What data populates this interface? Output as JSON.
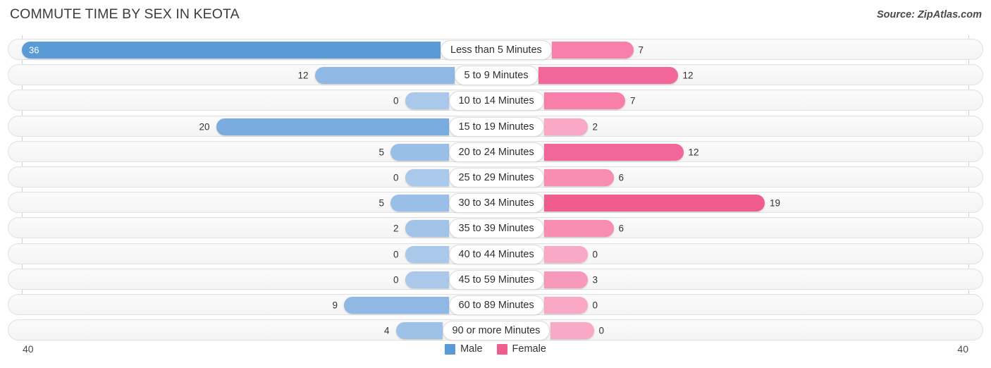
{
  "header": {
    "title": "COMMUTE TIME BY SEX IN KEOTA",
    "source": "Source: ZipAtlas.com"
  },
  "axis": {
    "left_tick": "40",
    "right_tick": "40"
  },
  "legend": {
    "items": [
      {
        "label": "Male",
        "color": "#5b9bd5"
      },
      {
        "label": "Female",
        "color": "#ef5d90"
      }
    ]
  },
  "chart_data": {
    "type": "bar",
    "title": "COMMUTE TIME BY SEX IN KEOTA",
    "subtitle": "Source: ZipAtlas.com",
    "orientation": "horizontal-diverging",
    "xlabel": "",
    "ylabel": "",
    "xlim": [
      40,
      40
    ],
    "axis_left_max": 40,
    "axis_right_max": 40,
    "grid": false,
    "legend_position": "bottom-center",
    "categories": [
      "Less than 5 Minutes",
      "5 to 9 Minutes",
      "10 to 14 Minutes",
      "15 to 19 Minutes",
      "20 to 24 Minutes",
      "25 to 29 Minutes",
      "30 to 34 Minutes",
      "35 to 39 Minutes",
      "40 to 44 Minutes",
      "45 to 59 Minutes",
      "60 to 89 Minutes",
      "90 or more Minutes"
    ],
    "series": [
      {
        "name": "Male",
        "color": "#5b9bd5",
        "values": [
          36,
          12,
          0,
          20,
          5,
          0,
          5,
          2,
          0,
          0,
          9,
          4
        ],
        "labels": [
          "36",
          "12",
          "0",
          "20",
          "5",
          "0",
          "5",
          "2",
          "0",
          "0",
          "9",
          "4"
        ]
      },
      {
        "name": "Female",
        "color": "#ef5d90",
        "values": [
          7,
          12,
          7,
          2,
          12,
          6,
          19,
          6,
          0,
          3,
          0,
          0
        ],
        "labels": [
          "7",
          "12",
          "7",
          "2",
          "12",
          "6",
          "19",
          "6",
          "0",
          "3",
          "0",
          "0"
        ]
      }
    ],
    "rows": [
      {
        "label": "Less than 5 Minutes",
        "male": 36,
        "female": 7,
        "male_label": "36",
        "female_label": "7",
        "male_color": "#5b9bd5",
        "female_color": "#f87fa9"
      },
      {
        "label": "5 to 9 Minutes",
        "male": 12,
        "female": 12,
        "male_label": "12",
        "female_label": "12",
        "male_color": "#8fb8e4",
        "female_color": "#f2679a"
      },
      {
        "label": "10 to 14 Minutes",
        "male": 0,
        "female": 7,
        "male_label": "0",
        "female_label": "7",
        "male_color": "#a9c8ea",
        "female_color": "#f87fa9"
      },
      {
        "label": "15 to 19 Minutes",
        "male": 20,
        "female": 2,
        "male_label": "20",
        "female_label": "2",
        "male_color": "#7aace0",
        "female_color": "#f9a8c5"
      },
      {
        "label": "20 to 24 Minutes",
        "male": 5,
        "female": 12,
        "male_label": "5",
        "female_label": "12",
        "male_color": "#99bfe7",
        "female_color": "#f2679a"
      },
      {
        "label": "25 to 29 Minutes",
        "male": 0,
        "female": 6,
        "male_label": "0",
        "female_label": "6",
        "male_color": "#a9c8ea",
        "female_color": "#f88cb1"
      },
      {
        "label": "30 to 34 Minutes",
        "male": 5,
        "female": 19,
        "male_label": "5",
        "female_label": "19",
        "male_color": "#99bfe7",
        "female_color": "#ef5d90"
      },
      {
        "label": "35 to 39 Minutes",
        "male": 2,
        "female": 6,
        "male_label": "2",
        "female_label": "6",
        "male_color": "#a2c3e8",
        "female_color": "#f88cb1"
      },
      {
        "label": "40 to 44 Minutes",
        "male": 0,
        "female": 0,
        "male_label": "0",
        "female_label": "0",
        "male_color": "#a9c8ea",
        "female_color": "#f9a8c5"
      },
      {
        "label": "45 to 59 Minutes",
        "male": 0,
        "female": 3,
        "male_label": "0",
        "female_label": "3",
        "male_color": "#a9c8ea",
        "female_color": "#f799ba"
      },
      {
        "label": "60 to 89 Minutes",
        "male": 9,
        "female": 0,
        "male_label": "9",
        "female_label": "0",
        "male_color": "#8fb8e4",
        "female_color": "#f9a8c5"
      },
      {
        "label": "90 or more Minutes",
        "male": 4,
        "female": 0,
        "male_label": "4",
        "female_label": "0",
        "male_color": "#9ec1e8",
        "female_color": "#f9a8c5"
      }
    ]
  }
}
